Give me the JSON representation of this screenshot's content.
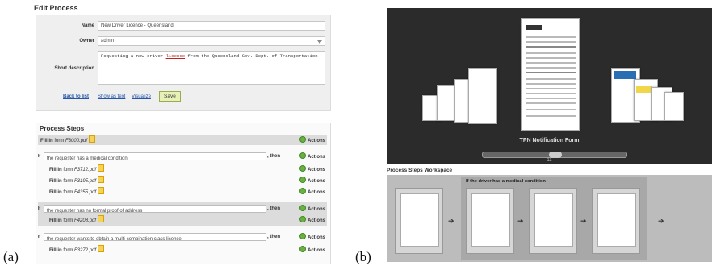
{
  "labels": {
    "a": "(a)",
    "b": "(b)"
  },
  "edit_process": {
    "title": "Edit Process",
    "name_label": "Name",
    "name_value": "New Driver Licence - Queensland",
    "owner_label": "Owner",
    "owner_value": "admin",
    "short_desc_label": "Short description",
    "short_desc_pre": "Requesting a new driver ",
    "short_desc_link": "licence",
    "short_desc_post": " from the Queensland Gov. Dept. of Transportation",
    "back_to_list": "Back to list",
    "show_as_text": "Show as text",
    "visualize": "Visualize",
    "save": "Save"
  },
  "process_steps": {
    "title": "Process Steps",
    "actions_label": "Actions",
    "fill_in": "Fill in",
    "form_word": "form",
    "then": ", then",
    "if_marker": "If",
    "top_form": "F3000.pdf",
    "conditions": [
      {
        "text": "the requester has a medical condition",
        "forms": [
          "F3712.pdf",
          "F3195.pdf",
          "F4355.pdf"
        ]
      },
      {
        "text": "the requester has no formal proof of address",
        "forms": [
          "F4208.pdf"
        ]
      },
      {
        "text": "the requestor wants to obtain a multi-combination class licence",
        "forms": [
          "F3272.pdf"
        ]
      }
    ]
  },
  "viewer": {
    "current_title": "TPN Notification Form",
    "page_number": "11"
  },
  "workspace": {
    "title": "Process Steps Workspace",
    "condition_label": "If the driver has a medical condition",
    "arrow": "➔"
  }
}
